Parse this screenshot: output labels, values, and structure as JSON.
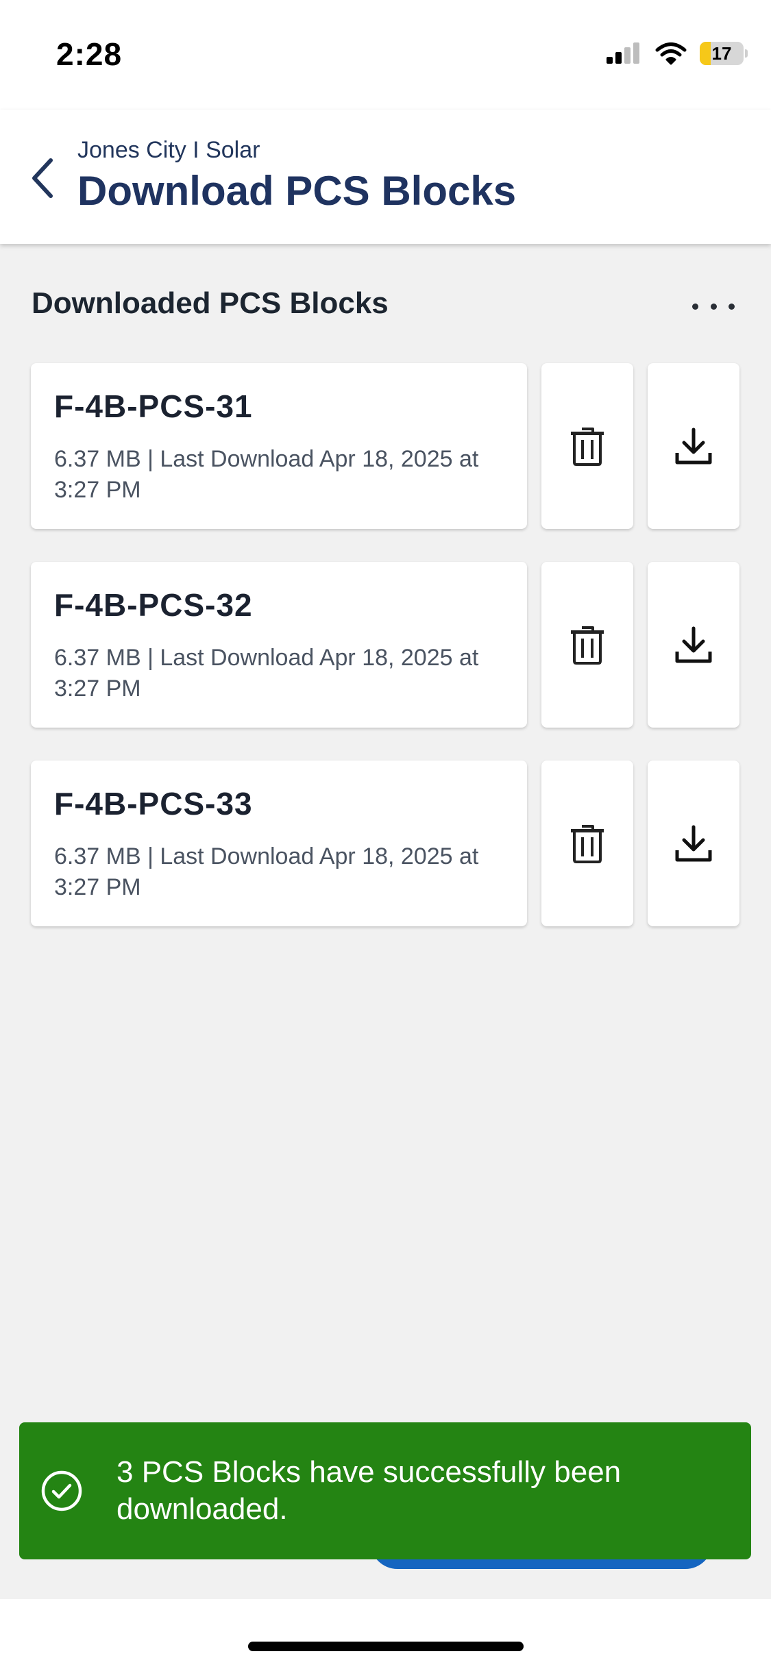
{
  "status_bar": {
    "time": "2:28",
    "battery_level": "17"
  },
  "header": {
    "breadcrumb": "Jones City I Solar",
    "title": "Download PCS Blocks"
  },
  "section": {
    "title": "Downloaded PCS Blocks"
  },
  "blocks": [
    {
      "name": "F-4B-PCS-31",
      "meta": "6.37 MB | Last Download Apr 18, 2025 at 3:27 PM"
    },
    {
      "name": "F-4B-PCS-32",
      "meta": "6.37 MB | Last Download Apr 18, 2025 at 3:27 PM"
    },
    {
      "name": "F-4B-PCS-33",
      "meta": "6.37 MB | Last Download Apr 18, 2025 at 3:27 PM"
    }
  ],
  "toast": {
    "message": "3 PCS Blocks have successfully been downloaded."
  },
  "colors": {
    "header_text": "#1f3360",
    "toast_bg": "#248413",
    "primary_button": "#1565c0",
    "battery_fill": "#f6c819"
  },
  "icons": {
    "back": "chevron-left-icon",
    "more": "more-horizontal-icon",
    "delete": "trash-icon",
    "download": "download-icon",
    "toast": "check-circle-icon"
  }
}
